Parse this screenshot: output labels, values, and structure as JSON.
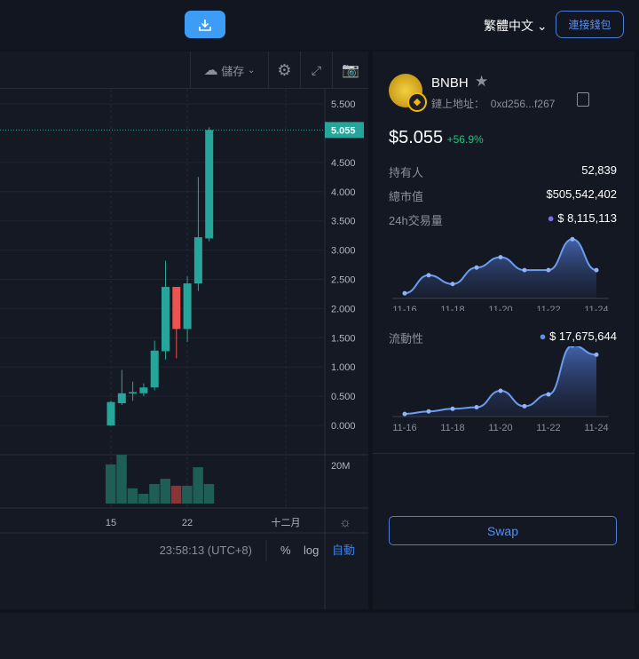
{
  "header": {
    "language": "繁體中文",
    "connect_wallet": "連接錢包"
  },
  "toolbar": {
    "save": "儲存"
  },
  "price_axis": [
    "5.500",
    "4.500",
    "4.000",
    "3.500",
    "3.000",
    "2.500",
    "2.000",
    "1.500",
    "1.000",
    "0.500",
    "0.000"
  ],
  "current_price_label": "5.055",
  "volume_axis": "20M",
  "time_axis": [
    "15",
    "22",
    "十二月"
  ],
  "footer": {
    "time": "23:58:13 (UTC+8)",
    "percent": "%",
    "log": "log",
    "auto": "自動"
  },
  "colors": {
    "up": "#26a69a",
    "down": "#ef5350",
    "accent": "#3d9cf5"
  },
  "chart_data": {
    "type": "candlestick",
    "candles": [
      {
        "day": 15,
        "o": 0.0,
        "h": 0.42,
        "l": 0.0,
        "c": 0.4,
        "v": 18
      },
      {
        "day": 16,
        "o": 0.38,
        "h": 0.95,
        "l": 0.35,
        "c": 0.55,
        "v": 22.4
      },
      {
        "day": 17,
        "o": 0.55,
        "h": 0.75,
        "l": 0.42,
        "c": 0.57,
        "v": 7
      },
      {
        "day": 18,
        "o": 0.55,
        "h": 0.72,
        "l": 0.5,
        "c": 0.65,
        "v": 4.5
      },
      {
        "day": 19,
        "o": 0.65,
        "h": 1.45,
        "l": 0.6,
        "c": 1.28,
        "v": 9
      },
      {
        "day": 20,
        "o": 1.27,
        "h": 2.82,
        "l": 1.13,
        "c": 2.37,
        "v": 11.4
      },
      {
        "day": 21,
        "o": 2.37,
        "h": 2.37,
        "l": 1.15,
        "c": 1.65,
        "v": 8.2
      },
      {
        "day": 22,
        "o": 1.65,
        "h": 2.55,
        "l": 1.43,
        "c": 2.43,
        "v": 8.2
      },
      {
        "day": 23,
        "o": 2.43,
        "h": 4.25,
        "l": 2.3,
        "c": 3.22,
        "v": 16.7
      },
      {
        "day": 24,
        "o": 3.2,
        "h": 5.1,
        "l": 3.15,
        "c": 5.055,
        "v": 9
      }
    ],
    "ylim": [
      0,
      5.5
    ],
    "volume_unit": "M"
  },
  "token": {
    "name": "BNBH",
    "address_label": "鏈上地址：",
    "address": "0xd256...f267",
    "price": "$5.055",
    "change": "+56.9%",
    "stats": [
      {
        "label": "持有人",
        "value": "52,839"
      },
      {
        "label": "總市值",
        "value": "$505,542,402"
      }
    ]
  },
  "volume_chart": {
    "label": "24h交易量",
    "value": "$ 8,115,113",
    "dot": "#7b6ee8",
    "x": [
      "11-16",
      "11-18",
      "11-20",
      "11-22",
      "11-24"
    ],
    "values": [
      0.1,
      0.45,
      0.28,
      0.6,
      0.8,
      0.55,
      0.55,
      1.15,
      0.55
    ]
  },
  "liquidity_chart": {
    "label": "流動性",
    "value": "$ 17,675,644",
    "dot": "#5b8ff0",
    "x": [
      "11-16",
      "11-18",
      "11-20",
      "11-22",
      "11-24"
    ],
    "values": [
      0.05,
      0.1,
      0.15,
      0.18,
      0.5,
      0.2,
      0.43,
      1.38,
      1.2
    ]
  },
  "swap": "Swap"
}
